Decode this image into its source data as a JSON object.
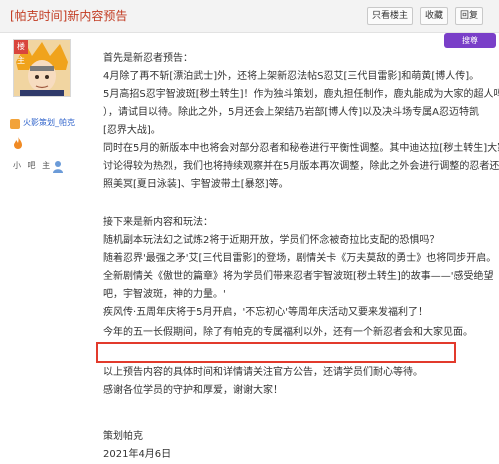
{
  "header": {
    "title": "[帕克时间]新内容预告",
    "buttons": [
      "只看楼主",
      "收藏",
      "回复"
    ]
  },
  "sidebar": {
    "lz_badge": "楼主",
    "username": "火影策划_帕克",
    "level_label": "小 吧 主"
  },
  "top_right_badge": "搜尊",
  "post": {
    "lines": [
      "首先是新忍者预告：",
      "4月除了再不斩[漂泊武士]外，还将上架新忍法帖S忍艾[三代目雷影]和萌黄[博人传]。",
      "5月高招S忍宇智波斑[秽土转生]！作为独斗策划，鹿丸担任制作，鹿丸能成为大家的超人吗（",
      "），请试目以待。除此之外，5月还会上架结乃岩部[博人传]以及决斗场专属A忍迈特凯",
      "[忍界大战]。",
      "同时在5月的新版本中也将会对部分忍者和秘卷进行平衡性调整。其中迪达拉[秽土转生]大家",
      "讨论得较为热烈，我们也将持续观察并在5月版本再次调整，除此之外会进行调整的忍者还有",
      "照美冥[夏日泳装]、宇智波带土[暴怒]等。",
      "",
      "接下来是新内容和玩法：",
      "随机副本玩法幻之试炼2将于近期开放，学员们怀念被奇拉比支配的恐惧吗？",
      "随着忍界'最强之矛'艾[三代目雷影]的登场，剧情关卡《万夫莫敌的勇士》也将同步开启。",
      "全新剧情关《傲世的篇章》将为学员们带来忍者宇智波斑[秽土转生]的故事——'感受绝望",
      "吧，宇智波斑，神的力量。'",
      "疾风传·五周年庆将于5月开启，'不忘初心'等周年庆活动又要来发福利了！",
      "今年的五一长假期间，除了有帕克的专属福利以外，还有一个新忍者会和大家见面。",
      "",
      "以上预告内容的具体时间和详情请关注官方公告，还请学员们耐心等待。",
      "感谢各位学员的守护和厚爱，谢谢大家！",
      "",
      "",
      "策划帕克",
      "2021年4月6日"
    ]
  },
  "colors": {
    "title": "#c23b22",
    "highlight_border": "#e23a2c",
    "username": "#3366cc"
  },
  "icons": [
    "flame-icon",
    "level-icon",
    "fan-badge-icon",
    "vip-icon"
  ]
}
